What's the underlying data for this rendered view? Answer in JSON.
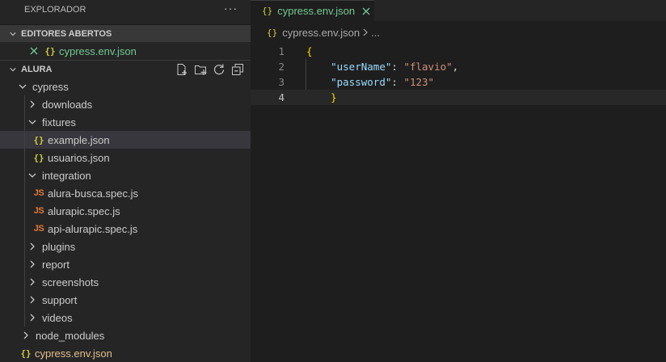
{
  "explorer": {
    "title": "EXPLORADOR",
    "more": "···"
  },
  "open_editors": {
    "header": "EDITORES ABERTOS",
    "items": [
      {
        "name": "cypress.env.json",
        "icon": "{}"
      }
    ]
  },
  "workspace": {
    "header": "ALURA",
    "actions": [
      "new-file-icon",
      "new-folder-icon",
      "refresh-icon",
      "collapse-all-icon"
    ],
    "tree": {
      "cypress": "cypress",
      "downloads": "downloads",
      "fixtures": "fixtures",
      "example_json": "example.json",
      "usuarios_json": "usuarios.json",
      "integration": "integration",
      "alura_busca": "alura-busca.spec.js",
      "alurapic": "alurapic.spec.js",
      "api_alurapic": "api-alurapic.spec.js",
      "plugins": "plugins",
      "report": "report",
      "screenshots": "screenshots",
      "support": "support",
      "videos": "videos",
      "node_modules": "node_modules",
      "cypress_env_json": "cypress.env.json"
    },
    "icons": {
      "json": "{}",
      "js": "JS"
    }
  },
  "editor": {
    "tab": {
      "label": "cypress.env.json",
      "icon": "{}"
    },
    "breadcrumb": {
      "file": "cypress.env.json",
      "more": "..."
    },
    "lines": [
      {
        "num": "1",
        "open": "{"
      },
      {
        "num": "2",
        "key": "\"userName\"",
        "colon": ": ",
        "value": "\"flavio\"",
        "comma": ","
      },
      {
        "num": "3",
        "key": "\"password\"",
        "colon": ": ",
        "value": "\"123\""
      },
      {
        "num": "4",
        "close": "}"
      }
    ]
  },
  "colors": {
    "sidebar_bg": "#252526",
    "editor_bg": "#1e1e1e",
    "json_icon": "#cbcb41",
    "js_icon": "#e37933",
    "modified_green": "#73c991",
    "modified_yellow": "#e2c08d",
    "json_key": "#9cdcfe",
    "json_string": "#ce9178",
    "bracket": "#ffd700"
  }
}
